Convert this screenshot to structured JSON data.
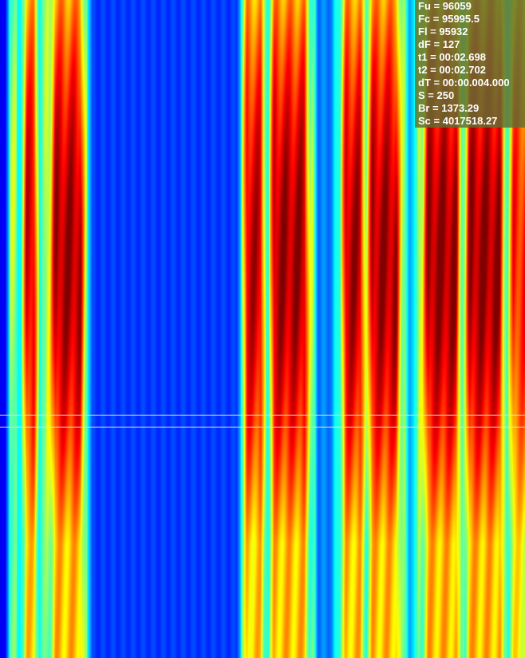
{
  "readout": {
    "fu": "Fu = 96059",
    "fc": "Fc = 95995.5",
    "fl": "Fl = 95932",
    "df": "dF = 127",
    "t1": "t1 = 00:02.698",
    "t2": "t2 = 00:02.702",
    "dt": "dT = 00:00.004.000",
    "s": "S = 250",
    "br": "Br = 1373.29",
    "sc": "Sc = 4017518.27"
  },
  "colormap": "jet",
  "colors": {
    "cursor_line": "#e8e8c8",
    "panel_background": "#5f6e32"
  }
}
